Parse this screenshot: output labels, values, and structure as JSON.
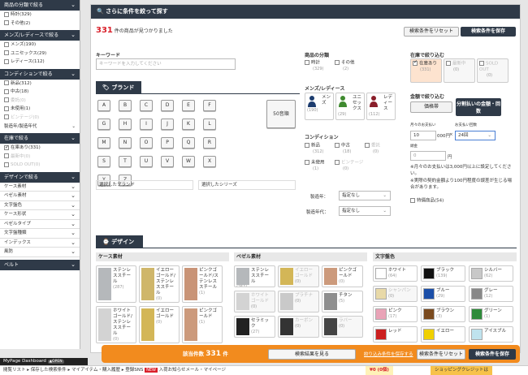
{
  "sidebar": {
    "sections": [
      {
        "title": "商品の分類で絞る",
        "items": [
          {
            "label": "時計(329)",
            "checked": false,
            "disabled": false
          },
          {
            "label": "その他(2)",
            "checked": false,
            "disabled": false
          }
        ]
      },
      {
        "title": "メンズ/レディースで絞る",
        "items": [
          {
            "label": "メンズ(190)",
            "checked": false,
            "disabled": false
          },
          {
            "label": "ユニセックス(29)",
            "checked": false,
            "disabled": false
          },
          {
            "label": "レディース(112)",
            "checked": false,
            "disabled": false
          }
        ]
      },
      {
        "title": "コンディションで絞る",
        "items": [
          {
            "label": "新品(312)",
            "checked": false,
            "disabled": false
          },
          {
            "label": "中古(18)",
            "checked": false,
            "disabled": false
          },
          {
            "label": "委託(0)",
            "checked": false,
            "disabled": true
          },
          {
            "label": "未使用(1)",
            "checked": false,
            "disabled": false
          },
          {
            "label": "ビンテージ(0)",
            "checked": false,
            "disabled": true
          }
        ],
        "select_label": "製造年/製造年代"
      },
      {
        "title": "在庫で絞る",
        "items": [
          {
            "label": "在庫あり(331)",
            "checked": true,
            "disabled": false
          },
          {
            "label": "最新中(0)",
            "checked": false,
            "disabled": true
          },
          {
            "label": "SOLD OUT(0)",
            "checked": false,
            "disabled": true
          }
        ]
      },
      {
        "title": "デザインで絞る",
        "accordions": [
          "ケース素材",
          "ベゼル素材",
          "文字盤色",
          "ケース形状",
          "ベゼルタイプ",
          "文字盤種類",
          "インデックス",
          "風防"
        ]
      },
      {
        "title": "ベルト"
      }
    ]
  },
  "main": {
    "header_title": "さらに条件を絞って探す",
    "result_count": "331",
    "result_text": "件の商品が見つかりました",
    "reset_button": "検索条件をリセット",
    "save_button": "検索条件を保存",
    "keyword_label": "キーワード",
    "keyword_placeholder": "キーワードを入力してください",
    "brand_tab": "ブランド",
    "brand_keys": [
      "A",
      "B",
      "C",
      "D",
      "E",
      "F",
      "G",
      "H",
      "I",
      "J",
      "K",
      "L",
      "M",
      "N",
      "O",
      "P",
      "Q",
      "R",
      "S",
      "T",
      "U",
      "V",
      "W",
      "X",
      "Y",
      "Z"
    ],
    "numeric_key": "50音順",
    "selected_brand": "選択したブランド",
    "selected_series": "選択したシリーズ",
    "category_label": "商品の分類",
    "category_options": [
      {
        "label": "時計",
        "count": "(329)"
      },
      {
        "label": "その他",
        "count": "(2)"
      }
    ],
    "gender_label": "メンズ/レディース",
    "gender_options": [
      {
        "label": "メンズ",
        "count": "(190)",
        "color": "#1c3c6e"
      },
      {
        "label": "ユニセックス",
        "count": "(29)",
        "color": "#3f8a2f"
      },
      {
        "label": "レディース",
        "count": "(112)",
        "color": "#8a1e2a"
      }
    ],
    "condition_label": "コンディション",
    "condition_options": [
      {
        "label": "新品",
        "count": "(312)",
        "disabled": false
      },
      {
        "label": "中古",
        "count": "(18)",
        "disabled": false
      },
      {
        "label": "委託",
        "count": "(0)",
        "disabled": true
      },
      {
        "label": "未使用",
        "count": "(1)",
        "disabled": false
      },
      {
        "label": "ビンテージ",
        "count": "(0)",
        "disabled": true
      }
    ],
    "year_label": "製造年：",
    "year_value": "指定なし",
    "era_label": "製造年代：",
    "era_value": "指定なし",
    "stock_label": "在庫で絞り込む",
    "stock_options": [
      {
        "label": "在庫あり",
        "count": "(331)",
        "checked": true,
        "disabled": false
      },
      {
        "label": "最新中",
        "count": "(0)",
        "checked": false,
        "disabled": true
      },
      {
        "label": "SOLD OUT",
        "count": "(0)",
        "checked": false,
        "disabled": true
      }
    ],
    "price_label": "金額で絞り込む",
    "price_button": "価格帯",
    "installment_button": "分割払いの金額・回数",
    "monthly_label": "月々のお支払い",
    "months_label": "お支払い回数",
    "monthly_value": "10",
    "monthly_unit": "000円",
    "times_sign": "×",
    "months_value": "24回",
    "down_label": "頭金",
    "down_value": "0",
    "yen": "円",
    "note1": "※月々のお支払いは3,000円以上に設定してください。",
    "note2": "※実際の契約金額より100円程度の誤差が生じる場合があります。",
    "special_label": "特價商品(54)",
    "design_tab": "デザイン",
    "case_label": "ケース素材",
    "case_cards": [
      {
        "label": "ステンレススチール",
        "count": "(287)",
        "color": "#b5b8bb",
        "disabled": false
      },
      {
        "label": "イエローゴールド/ステンレススチール",
        "count": "(0)",
        "color": "#cfb66a",
        "disabled": false
      },
      {
        "label": "ピンクゴールド/ステンレススチール",
        "count": "(1)",
        "color": "#c99477",
        "disabled": false
      },
      {
        "label": "ホワイトゴールド/ステンレススチール",
        "count": "(0)",
        "color": "#d3d3d3",
        "disabled": false
      },
      {
        "label": "イエローゴールド",
        "count": "(0)",
        "color": "#d3b657",
        "disabled": false
      },
      {
        "label": "ピンクゴールド",
        "count": "(1)",
        "color": "#cc9a7c",
        "disabled": false
      }
    ],
    "bezel_label": "ベゼル素材",
    "bezel_cards": [
      {
        "label": "ステンレススチール",
        "count": "(251)",
        "color": "#b5b8bb",
        "disabled": false
      },
      {
        "label": "イエローゴールド",
        "count": "(0)",
        "color": "#d3b657",
        "disabled": true
      },
      {
        "label": "ピンクゴールド",
        "count": "(0)",
        "color": "#cc9a7c",
        "disabled": false
      },
      {
        "label": "ホワイトゴールド",
        "count": "(0)",
        "color": "#d3d3d3",
        "disabled": true
      },
      {
        "label": "プラチナ",
        "count": "(0)",
        "color": "#c9c9c9",
        "disabled": true
      },
      {
        "label": "チタン",
        "count": "(5)",
        "color": "#8f8f8f",
        "disabled": false
      },
      {
        "label": "セラミック",
        "count": "(27)",
        "color": "#222222",
        "disabled": false
      },
      {
        "label": "カーボン",
        "count": "(0)",
        "color": "#333333",
        "disabled": true
      },
      {
        "label": "ラバー",
        "count": "(0)",
        "color": "#444444",
        "disabled": true
      }
    ],
    "dial_label": "文字盤色",
    "dial_cards": [
      {
        "label": "ホワイト",
        "count": "(64)",
        "color": "#ffffff",
        "disabled": false
      },
      {
        "label": "ブラック",
        "count": "(139)",
        "color": "#111111",
        "disabled": false
      },
      {
        "label": "シルバー",
        "count": "(62)",
        "color": "#c8c8c8",
        "disabled": false
      },
      {
        "label": "シャンパン",
        "count": "(0)",
        "color": "#e8d9a8",
        "disabled": true
      },
      {
        "label": "ブルー",
        "count": "(29)",
        "color": "#1c4fa8",
        "disabled": false
      },
      {
        "label": "グレー",
        "count": "(12)",
        "color": "#888888",
        "disabled": false
      },
      {
        "label": "ピンク",
        "count": "(17)",
        "color": "#e9a3b7",
        "disabled": false
      },
      {
        "label": "ブラウン",
        "count": "(3)",
        "color": "#7a4a1e",
        "disabled": false
      },
      {
        "label": "グリーン",
        "count": "(1)",
        "color": "#2e8b3a",
        "disabled": false
      },
      {
        "label": "レッド",
        "count": "",
        "color": "#cc1f1f",
        "disabled": false
      },
      {
        "label": "イエロー",
        "count": "",
        "color": "#f0d000",
        "disabled": false
      },
      {
        "label": "アイスブル",
        "count": "",
        "color": "#bfe3ee",
        "disabled": false
      }
    ]
  },
  "bottom_bar": {
    "count_label": "該当件数",
    "count_value": "331",
    "count_unit": "件",
    "view_results": "検索結果を見る",
    "save_link": "絞り込み条件を保存する",
    "reset": "検索条件をリセット",
    "save": "検索条件を保存"
  },
  "footer": {
    "mypage": "MyPage Dashboard",
    "open_tag": "▲OPEN",
    "links": "閲覧リスト ▸  保存した検索条件 ▸  マイアイテム・購入履歴 ▸  登録SNS",
    "new_tag": "NEW",
    "news": "入荷お知らせメール・マイページ",
    "points": "¥0 (0個)",
    "shopping": "ショッピングクレジットは"
  }
}
